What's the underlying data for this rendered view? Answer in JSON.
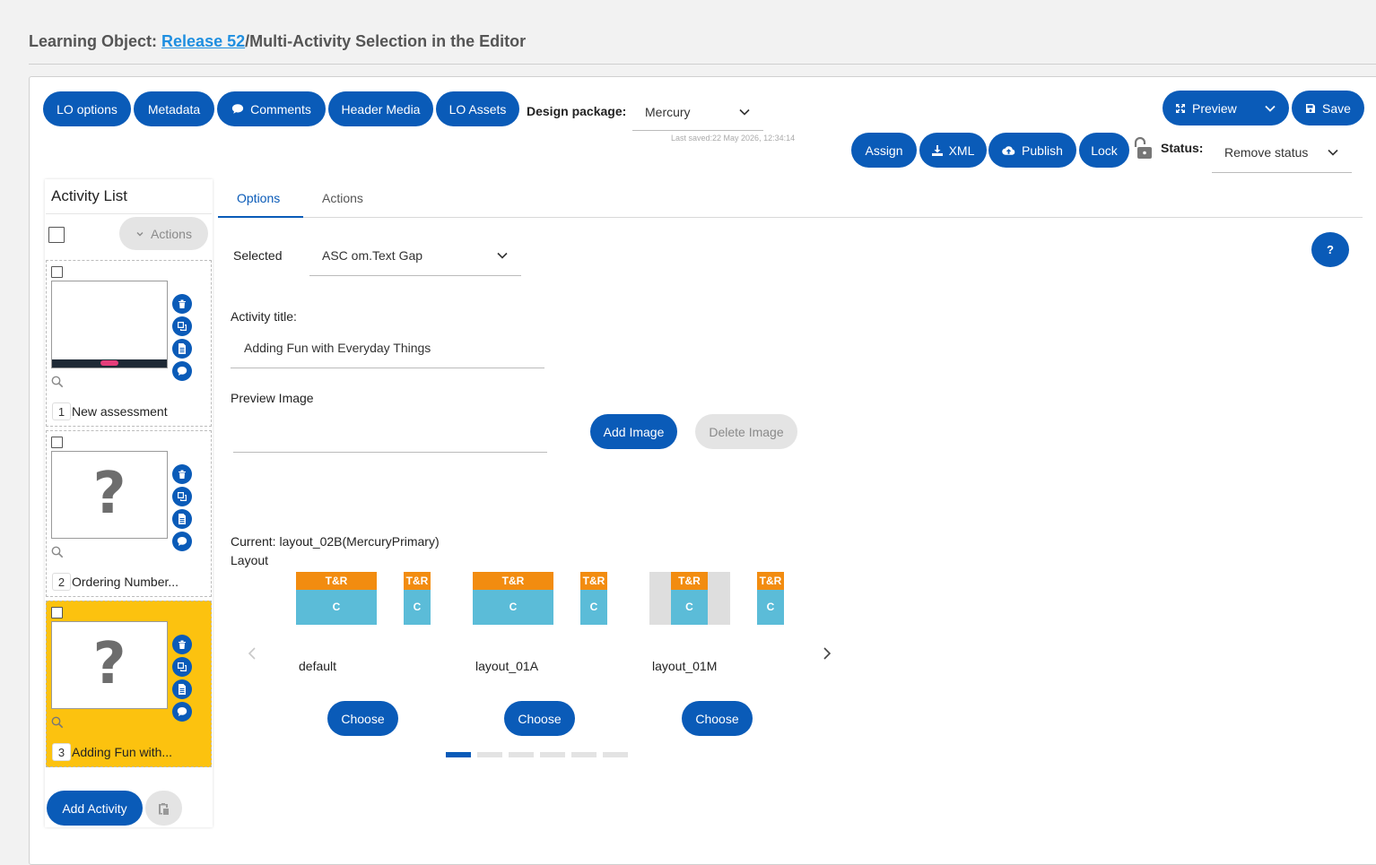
{
  "header": {
    "prefix": "Learning Object: ",
    "link": "Release 52",
    "suffix": "/Multi-Activity Selection in the Editor"
  },
  "toolbar": {
    "lo_options": "LO options",
    "metadata": "Metadata",
    "comments": "Comments",
    "header_media": "Header Media",
    "lo_assets": "LO Assets",
    "design_package_label": "Design package:",
    "design_package_value": "Mercury",
    "last_saved": "Last saved:22 May 2026, 12:34:14",
    "preview": "Preview",
    "save": "Save",
    "assign": "Assign",
    "xml": "XML",
    "publish": "Publish",
    "lock": "Lock",
    "status_label": "Status:",
    "status_value": "Remove status"
  },
  "activity_list": {
    "title": "Activity List",
    "actions": "Actions",
    "items": [
      {
        "number": "1",
        "name": "New assessment"
      },
      {
        "number": "2",
        "name": "Ordering Number..."
      },
      {
        "number": "3",
        "name": "Adding Fun with..."
      }
    ],
    "add_activity": "Add Activity"
  },
  "tabs": {
    "options": "Options",
    "actions": "Actions"
  },
  "options": {
    "selected_label": "Selected",
    "selected_value": "ASC om.Text Gap",
    "help": "?",
    "activity_title_label": "Activity title:",
    "activity_title_value": "Adding Fun with Everyday Things",
    "preview_image_label": "Preview Image",
    "add_image": "Add Image",
    "delete_image": "Delete Image",
    "current_layout": "Current: layout_02B(MercuryPrimary)",
    "layout_label": "Layout",
    "tr": "T&R",
    "c": "C",
    "layouts": [
      {
        "name": "default",
        "choose": "Choose"
      },
      {
        "name": "layout_01A",
        "choose": "Choose"
      },
      {
        "name": "layout_01M",
        "choose": "Choose"
      }
    ]
  },
  "colors": {
    "primary": "#0a5bb8",
    "selected_card": "#fcc20f",
    "layout_header": "#f28c10",
    "layout_body": "#5bbcd8"
  }
}
